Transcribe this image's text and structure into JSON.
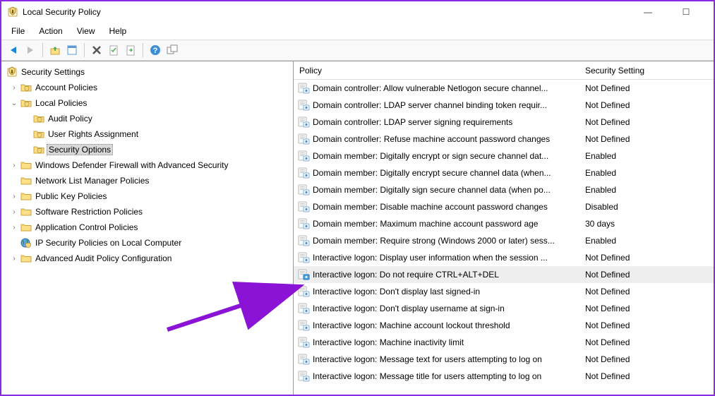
{
  "window": {
    "title": "Local Security Policy"
  },
  "menu": {
    "file": "File",
    "action": "Action",
    "view": "View",
    "help": "Help"
  },
  "tree": {
    "root": "Security Settings",
    "account": "Account Policies",
    "local": "Local Policies",
    "audit": "Audit Policy",
    "ura": "User Rights Assignment",
    "secopt": "Security Options",
    "wdfw": "Windows Defender Firewall with Advanced Security",
    "nlm": "Network List Manager Policies",
    "pkp": "Public Key Policies",
    "srp": "Software Restriction Policies",
    "acp": "Application Control Policies",
    "ipsec": "IP Security Policies on Local Computer",
    "aapc": "Advanced Audit Policy Configuration"
  },
  "listHeaders": {
    "policy": "Policy",
    "setting": "Security Setting"
  },
  "policies": [
    {
      "name": "Domain controller: Allow vulnerable Netlogon secure channel...",
      "setting": "Not Defined"
    },
    {
      "name": "Domain controller: LDAP server channel binding token requir...",
      "setting": "Not Defined"
    },
    {
      "name": "Domain controller: LDAP server signing requirements",
      "setting": "Not Defined"
    },
    {
      "name": "Domain controller: Refuse machine account password changes",
      "setting": "Not Defined"
    },
    {
      "name": "Domain member: Digitally encrypt or sign secure channel dat...",
      "setting": "Enabled"
    },
    {
      "name": "Domain member: Digitally encrypt secure channel data (when...",
      "setting": "Enabled"
    },
    {
      "name": "Domain member: Digitally sign secure channel data (when po...",
      "setting": "Enabled"
    },
    {
      "name": "Domain member: Disable machine account password changes",
      "setting": "Disabled"
    },
    {
      "name": "Domain member: Maximum machine account password age",
      "setting": "30 days"
    },
    {
      "name": "Domain member: Require strong (Windows 2000 or later) sess...",
      "setting": "Enabled"
    },
    {
      "name": "Interactive logon: Display user information when the session ...",
      "setting": "Not Defined"
    },
    {
      "name": "Interactive logon: Do not require CTRL+ALT+DEL",
      "setting": "Not Defined",
      "selected": true
    },
    {
      "name": "Interactive logon: Don't display last signed-in",
      "setting": "Not Defined"
    },
    {
      "name": "Interactive logon: Don't display username at sign-in",
      "setting": "Not Defined"
    },
    {
      "name": "Interactive logon: Machine account lockout threshold",
      "setting": "Not Defined"
    },
    {
      "name": "Interactive logon: Machine inactivity limit",
      "setting": "Not Defined"
    },
    {
      "name": "Interactive logon: Message text for users attempting to log on",
      "setting": "Not Defined"
    },
    {
      "name": "Interactive logon: Message title for users attempting to log on",
      "setting": "Not Defined"
    }
  ]
}
